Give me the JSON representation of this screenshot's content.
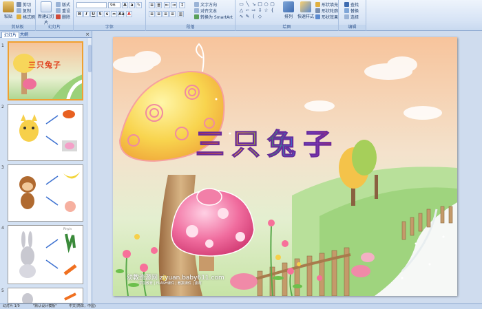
{
  "ribbon": {
    "clipboard": {
      "paste": "粘贴",
      "cut": "剪切",
      "copy": "复制",
      "format_painter": "格式刷",
      "label": "剪贴板"
    },
    "slides": {
      "new_slide": "新建幻灯片",
      "layout": "版式",
      "reset": "重设",
      "delete": "删除",
      "label": "幻灯片"
    },
    "font": {
      "font_name": "",
      "font_size": "96",
      "label": "字体"
    },
    "paragraph": {
      "text_direction": "文字方向",
      "align_text": "对齐文本",
      "smartart": "转换为 SmartArt",
      "label": "段落"
    },
    "drawing": {
      "arrange": "排列",
      "quick_styles": "快速样式",
      "shape_fill": "形状填充",
      "shape_outline": "形状轮廓",
      "shape_effects": "形状效果",
      "label": "绘图"
    },
    "editing": {
      "find": "查找",
      "replace": "替换",
      "select": "选择",
      "label": "编辑"
    }
  },
  "left_panel": {
    "tab_slides": "幻灯片",
    "tab_outline": "大纲",
    "close": "×",
    "thumbnails": [
      {
        "num": "1",
        "title": "三只兔子"
      },
      {
        "num": "2"
      },
      {
        "num": "3"
      },
      {
        "num": "4",
        "extra": "Pinyin"
      },
      {
        "num": "5"
      }
    ]
  },
  "slide": {
    "title": "三只兔子",
    "watermark": "幼教资源网 ziyuan.baby611.com",
    "watermark_sub": "学前教育 | FLASH课件 | 教案课件 | 素材"
  },
  "statusbar": {
    "slide_info": "幻灯片 1/9",
    "theme": "\"默认设计模板\"",
    "language": "中文(简体，中国)"
  },
  "colors": {
    "accent": "#f0a030",
    "ribbon_bg": "#d6e3f5"
  }
}
